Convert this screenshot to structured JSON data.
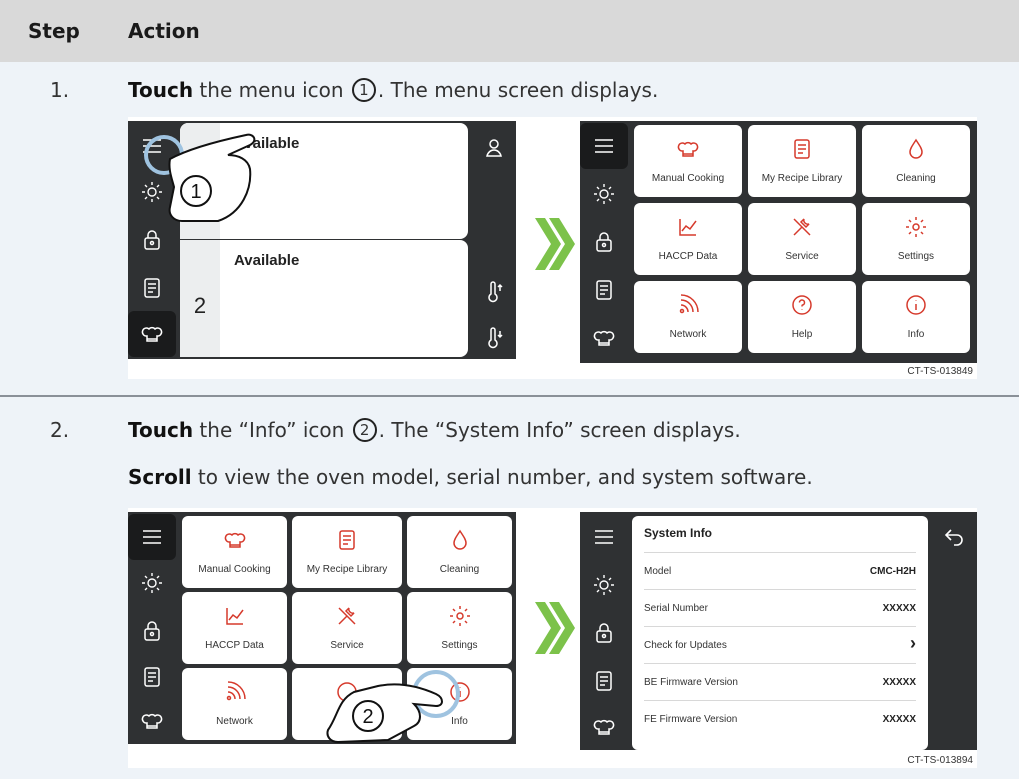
{
  "table": {
    "col_step": "Step",
    "col_action": "Action"
  },
  "steps": [
    {
      "num": "1.",
      "verb": "Touch",
      "text_a": " the menu icon ",
      "marker": "1",
      "text_b": ". The menu screen displays."
    },
    {
      "num": "2.",
      "verb": "Touch",
      "text_a": " the “Info” icon ",
      "marker": "2",
      "text_b": ". The “System Info” screen displays.",
      "verb2": "Scroll",
      "text_c": " to view the oven model, serial number, and system software."
    }
  ],
  "figure1": {
    "id": "CT-TS-013849",
    "left_screen": {
      "panel1_label": "Available",
      "panel2_label": "Available",
      "panel2_num": "2",
      "callout": "1"
    },
    "right_screen": {
      "tiles": [
        "Manual Cooking",
        "My Recipe Library",
        "Cleaning",
        "HACCP Data",
        "Service",
        "Settings",
        "Network",
        "Help",
        "Info"
      ]
    }
  },
  "figure2": {
    "id": "CT-TS-013894",
    "left_screen": {
      "tiles": [
        "Manual Cooking",
        "My Recipe Library",
        "Cleaning",
        "HACCP Data",
        "Service",
        "Settings",
        "Network",
        "Info"
      ],
      "callout": "2"
    },
    "right_screen": {
      "title": "System Info",
      "rows": [
        {
          "k": "Model",
          "v": "CMC-H2H"
        },
        {
          "k": "Serial Number",
          "v": "XXXXX"
        },
        {
          "k": "Check for Updates",
          "v": "›"
        },
        {
          "k": "BE Firmware Version",
          "v": "XXXXX"
        },
        {
          "k": "FE Firmware Version",
          "v": "XXXXX"
        }
      ]
    }
  },
  "colors": {
    "accent_red": "#d63a2c",
    "arrow_green": "#7cc24a",
    "screen_dark": "#2f3133",
    "header_gray": "#d9d9d9"
  },
  "icons": {
    "sidebar": [
      "menu-icon",
      "sun-icon",
      "lock-icon",
      "recipe-icon",
      "chef-hat-icon"
    ],
    "tiles": [
      "chef-hat-icon",
      "recipe-book-icon",
      "water-drop-icon",
      "chart-icon",
      "wrench-icon",
      "gear-icon",
      "wifi-icon",
      "help-icon",
      "info-icon"
    ]
  }
}
